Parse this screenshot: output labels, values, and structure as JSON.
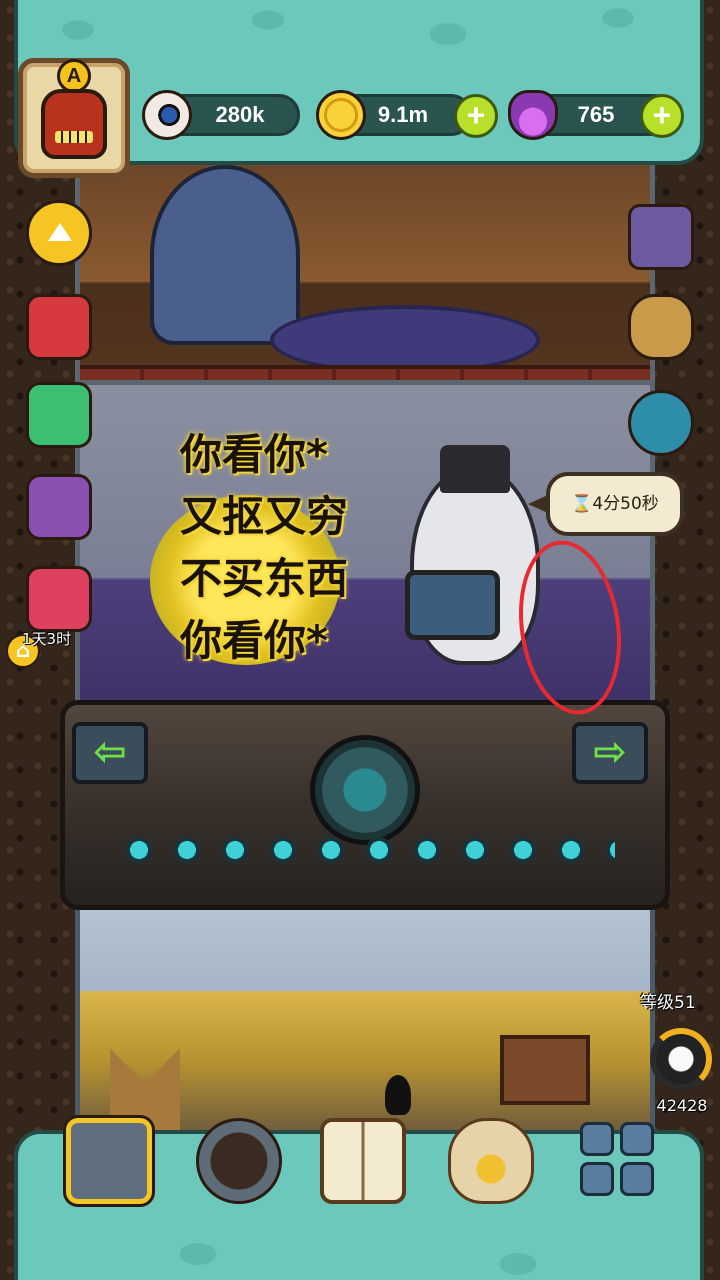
{
  "hud": {
    "eyes": "280k",
    "coins": "9.1m",
    "potions": "765",
    "plus_symbol": "+",
    "avatar_grade": "A"
  },
  "caption": {
    "line1": "你看你*",
    "line2": "又抠又穷",
    "line3": "不买东西",
    "line4": "你看你*"
  },
  "timer_bubble": "⌛4分50秒",
  "left_side": {
    "pack_timer": "1天3时",
    "home_symbol": "⌂"
  },
  "right_side": {
    "level": "等级51",
    "count": "42428"
  },
  "nav_arrows": {
    "left": "⇦",
    "right": "⇨"
  },
  "icons": {
    "eye": "eye-icon",
    "coin": "coin-icon",
    "potion": "potion-icon"
  },
  "colors": {
    "hud_teal": "#6cc8bb",
    "plus_green": "#b6e02a",
    "annotation_red": "#e8292f",
    "caption_glow": "#f0d53a"
  }
}
